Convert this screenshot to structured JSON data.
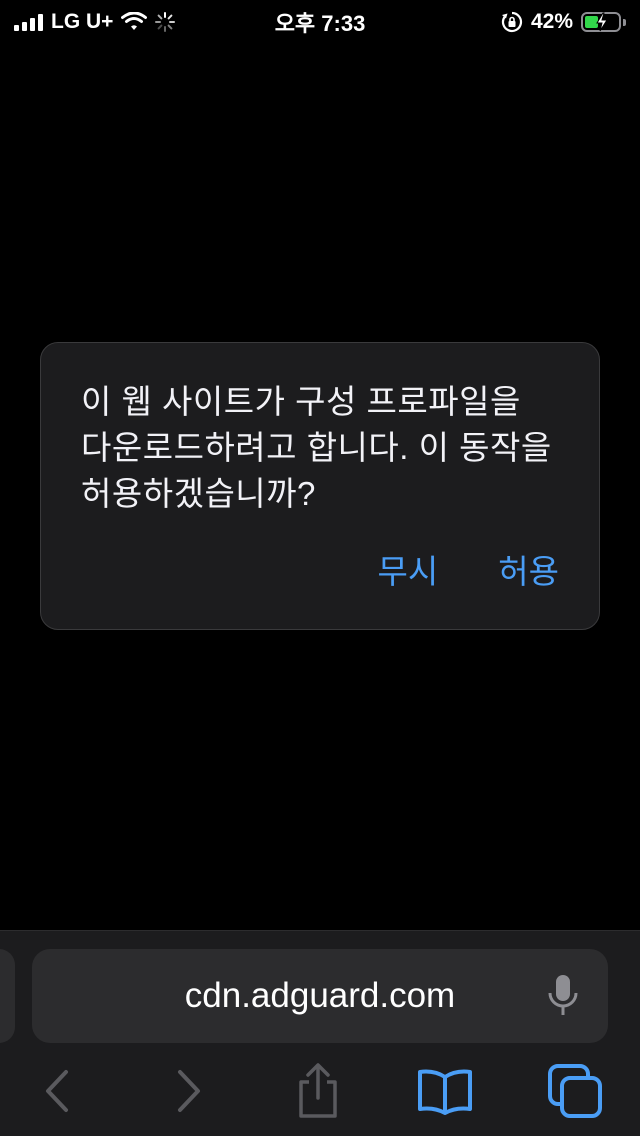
{
  "status_bar": {
    "carrier": "LG U+",
    "time": "오후 7:33",
    "battery_percent": "42%",
    "battery_level": 0.42,
    "icons": [
      "signal-icon",
      "wifi-icon",
      "activity-spinner-icon",
      "orientation-lock-icon",
      "battery-charging-icon"
    ]
  },
  "alert": {
    "message": "이 웹 사이트가 구성 프로파일을 다운로드하려고 합니다. 이 동작을 허용하겠습니까?",
    "ignore_label": "무시",
    "allow_label": "허용"
  },
  "address_bar": {
    "url": "cdn.adguard.com"
  },
  "toolbar": {
    "icons": [
      "back-icon",
      "forward-icon",
      "share-icon",
      "bookmarks-icon",
      "tabs-icon"
    ]
  },
  "colors": {
    "background": "#000000",
    "alert_bg": "#1c1c1e",
    "accent": "#4a9df5",
    "battery": "#32d74b"
  }
}
